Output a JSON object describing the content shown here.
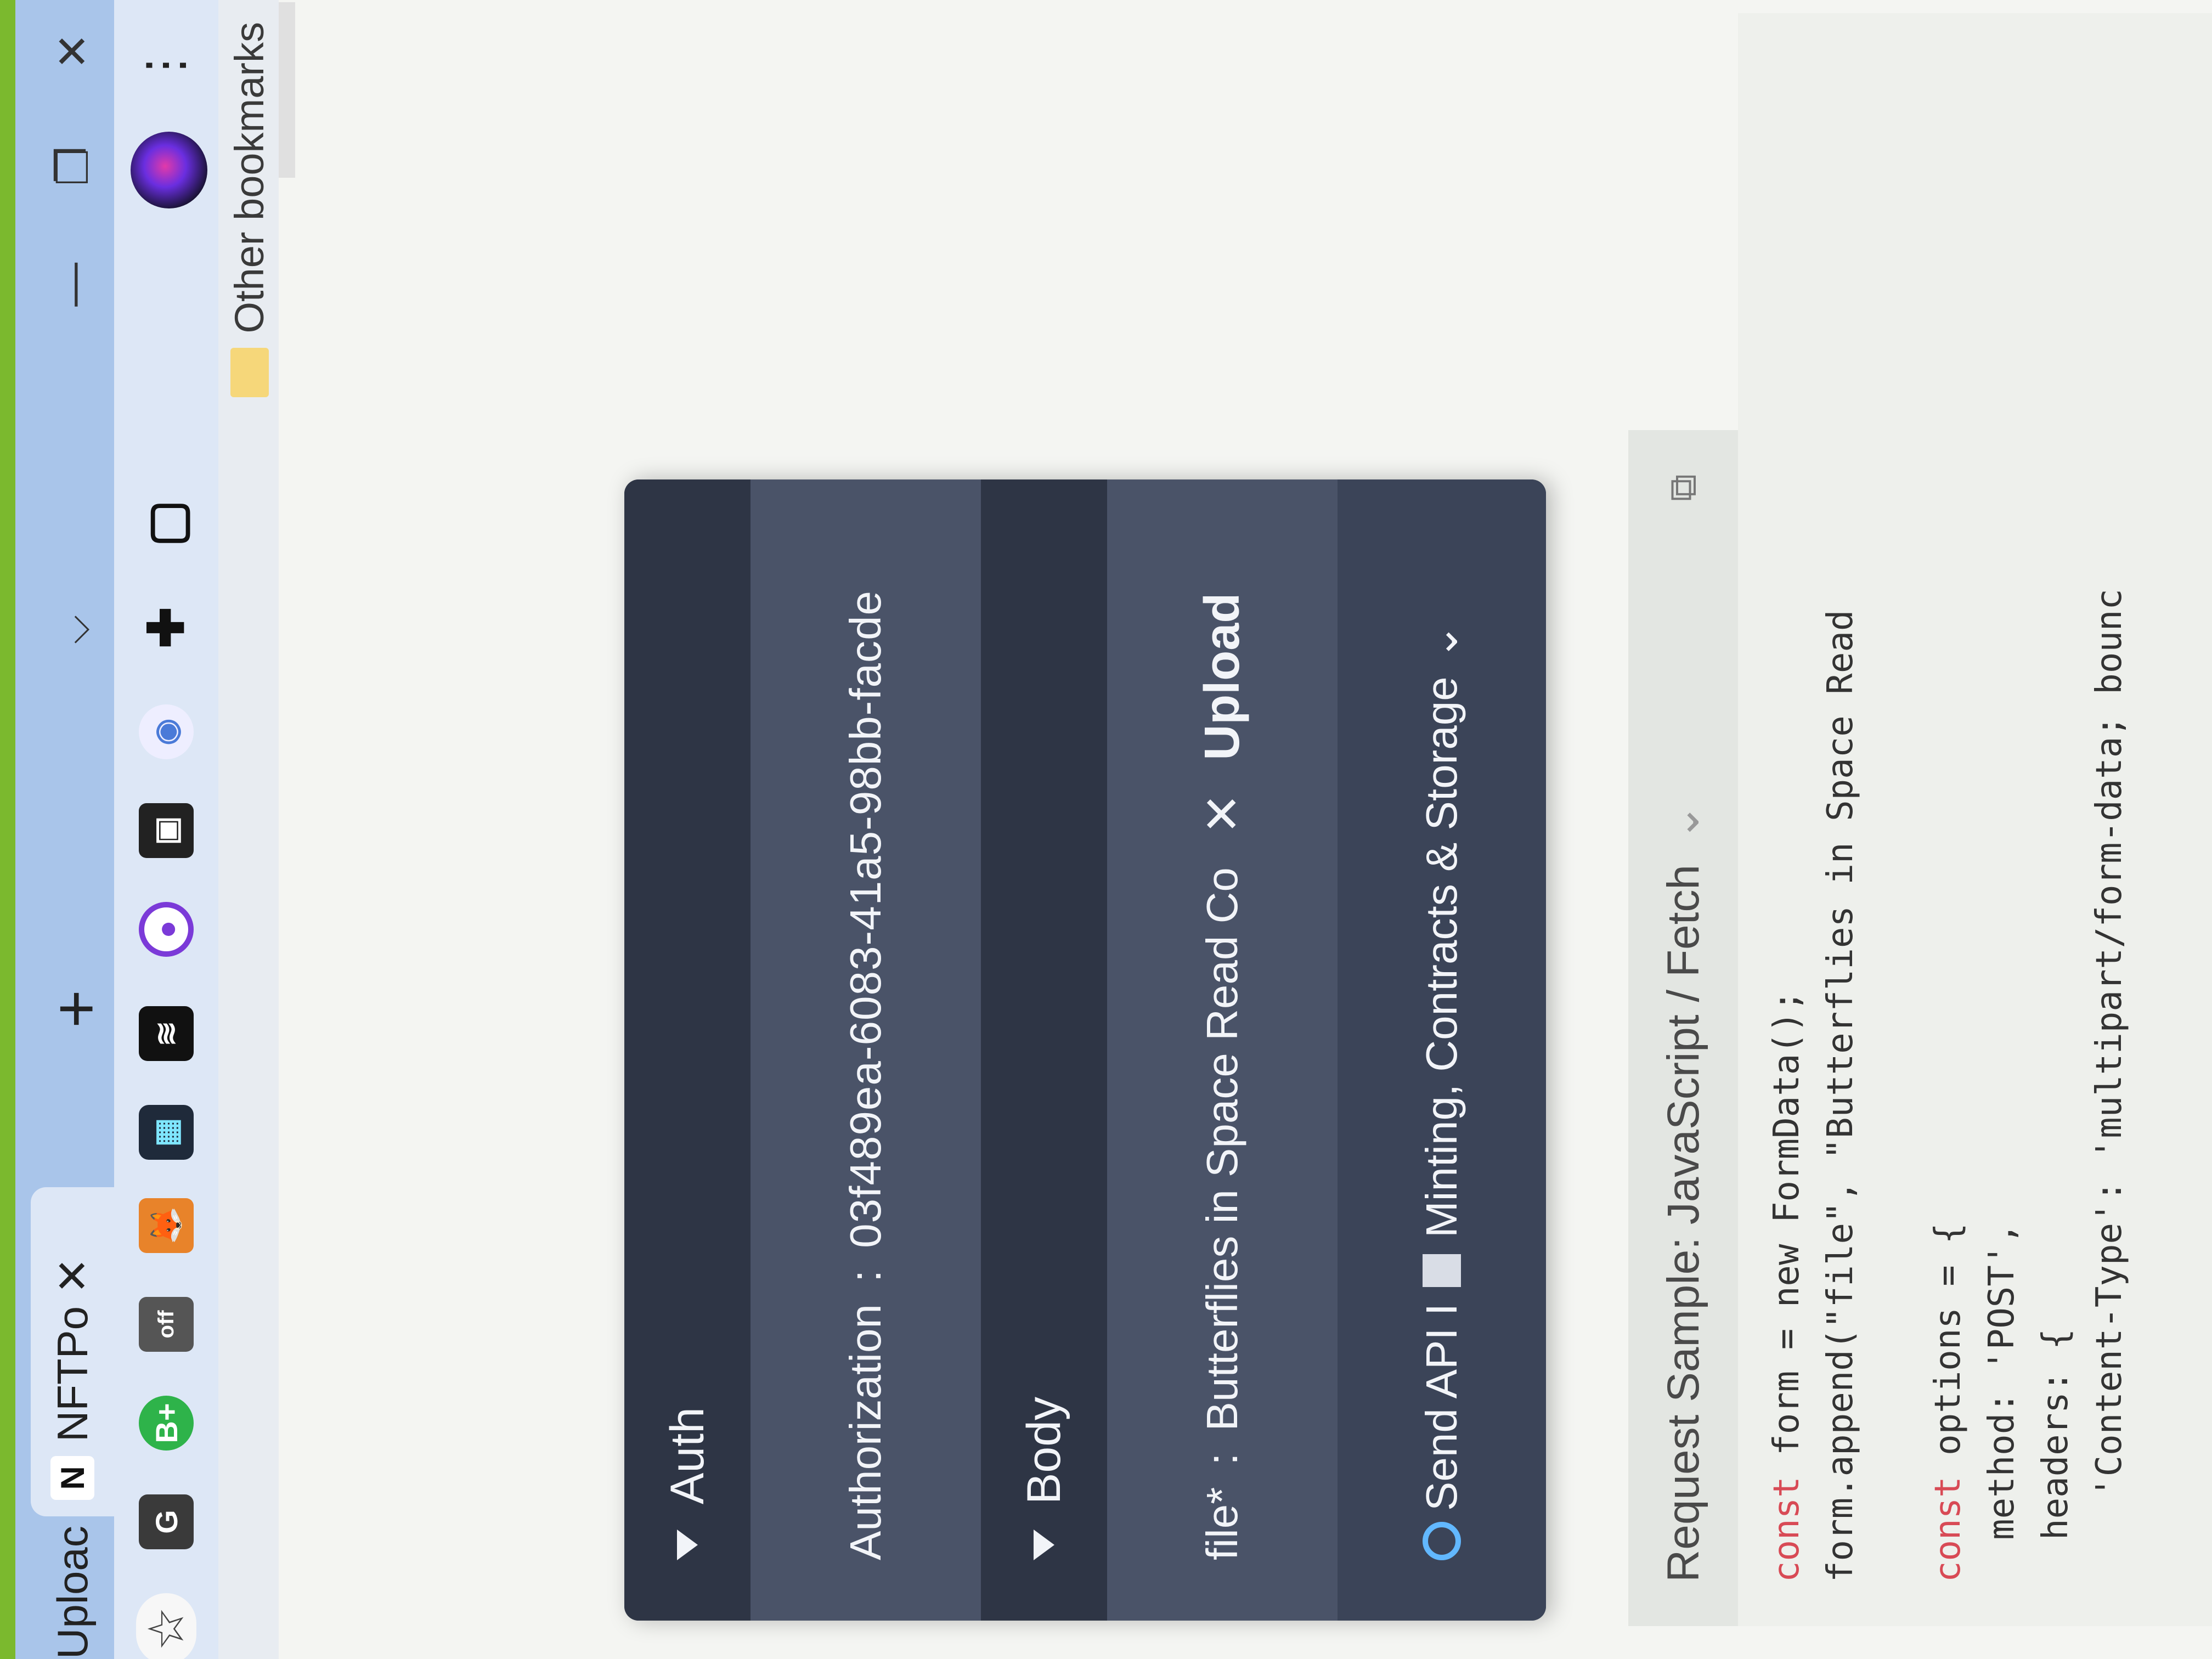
{
  "tabs": [
    {
      "label": "Uploac",
      "close": "✕"
    },
    {
      "label": "NFTPo",
      "icon": "N",
      "close": "✕"
    }
  ],
  "new_tab": "+",
  "tab_search": "⌵",
  "window_controls": {
    "minimize": "—",
    "restore": "❐",
    "close": "✕"
  },
  "toolbar": {
    "menu": "⋮",
    "extensions": [
      "bookmark-star-icon",
      "profile-ext-icon",
      "bplus-ext-icon",
      "off-ext-icon",
      "metamask-icon",
      "pink-app-icon",
      "wave-ext-icon",
      "purple-ring-icon",
      "qr-ext-icon",
      "owl-ext-icon",
      "puzzle-icon",
      "window-icon"
    ]
  },
  "bookmarks": {
    "other_label": "Other bookmarks"
  },
  "api_card": {
    "auth_label": "Auth",
    "authorization_key": "Authorization",
    "authorization_sep": ":",
    "authorization_value": "03f489ea-6083-41a5-98bb-facde",
    "body_label": "Body",
    "file_key": "file*",
    "file_sep": ":",
    "file_value": "Butterflies in Space Read Co",
    "file_clear": "✕",
    "upload_label": "Upload",
    "send_label": "Send API I",
    "category_label": "Minting, Contracts & Storage",
    "category_chevron": "⌄"
  },
  "request_sample": {
    "title": "Request Sample: JavaScript / Fetch",
    "chevron": "⌄",
    "copy_icon": "copy-icon",
    "code_lines": [
      "const form = new FormData();",
      "form.append(\"file\", \"Butterflies in Space Read",
      "",
      "const options = {",
      "  method: 'POST',",
      "  headers: {",
      "    'Content-Type': 'multipart/form-data; bounc"
    ]
  },
  "colors": {
    "card_bg": "#3b4458",
    "card_header": "#2e3545",
    "tab_strip": "#a9c5ea",
    "keyword": "#d84a55",
    "function": "#5a9a3c",
    "method": "#3b6fd0"
  }
}
